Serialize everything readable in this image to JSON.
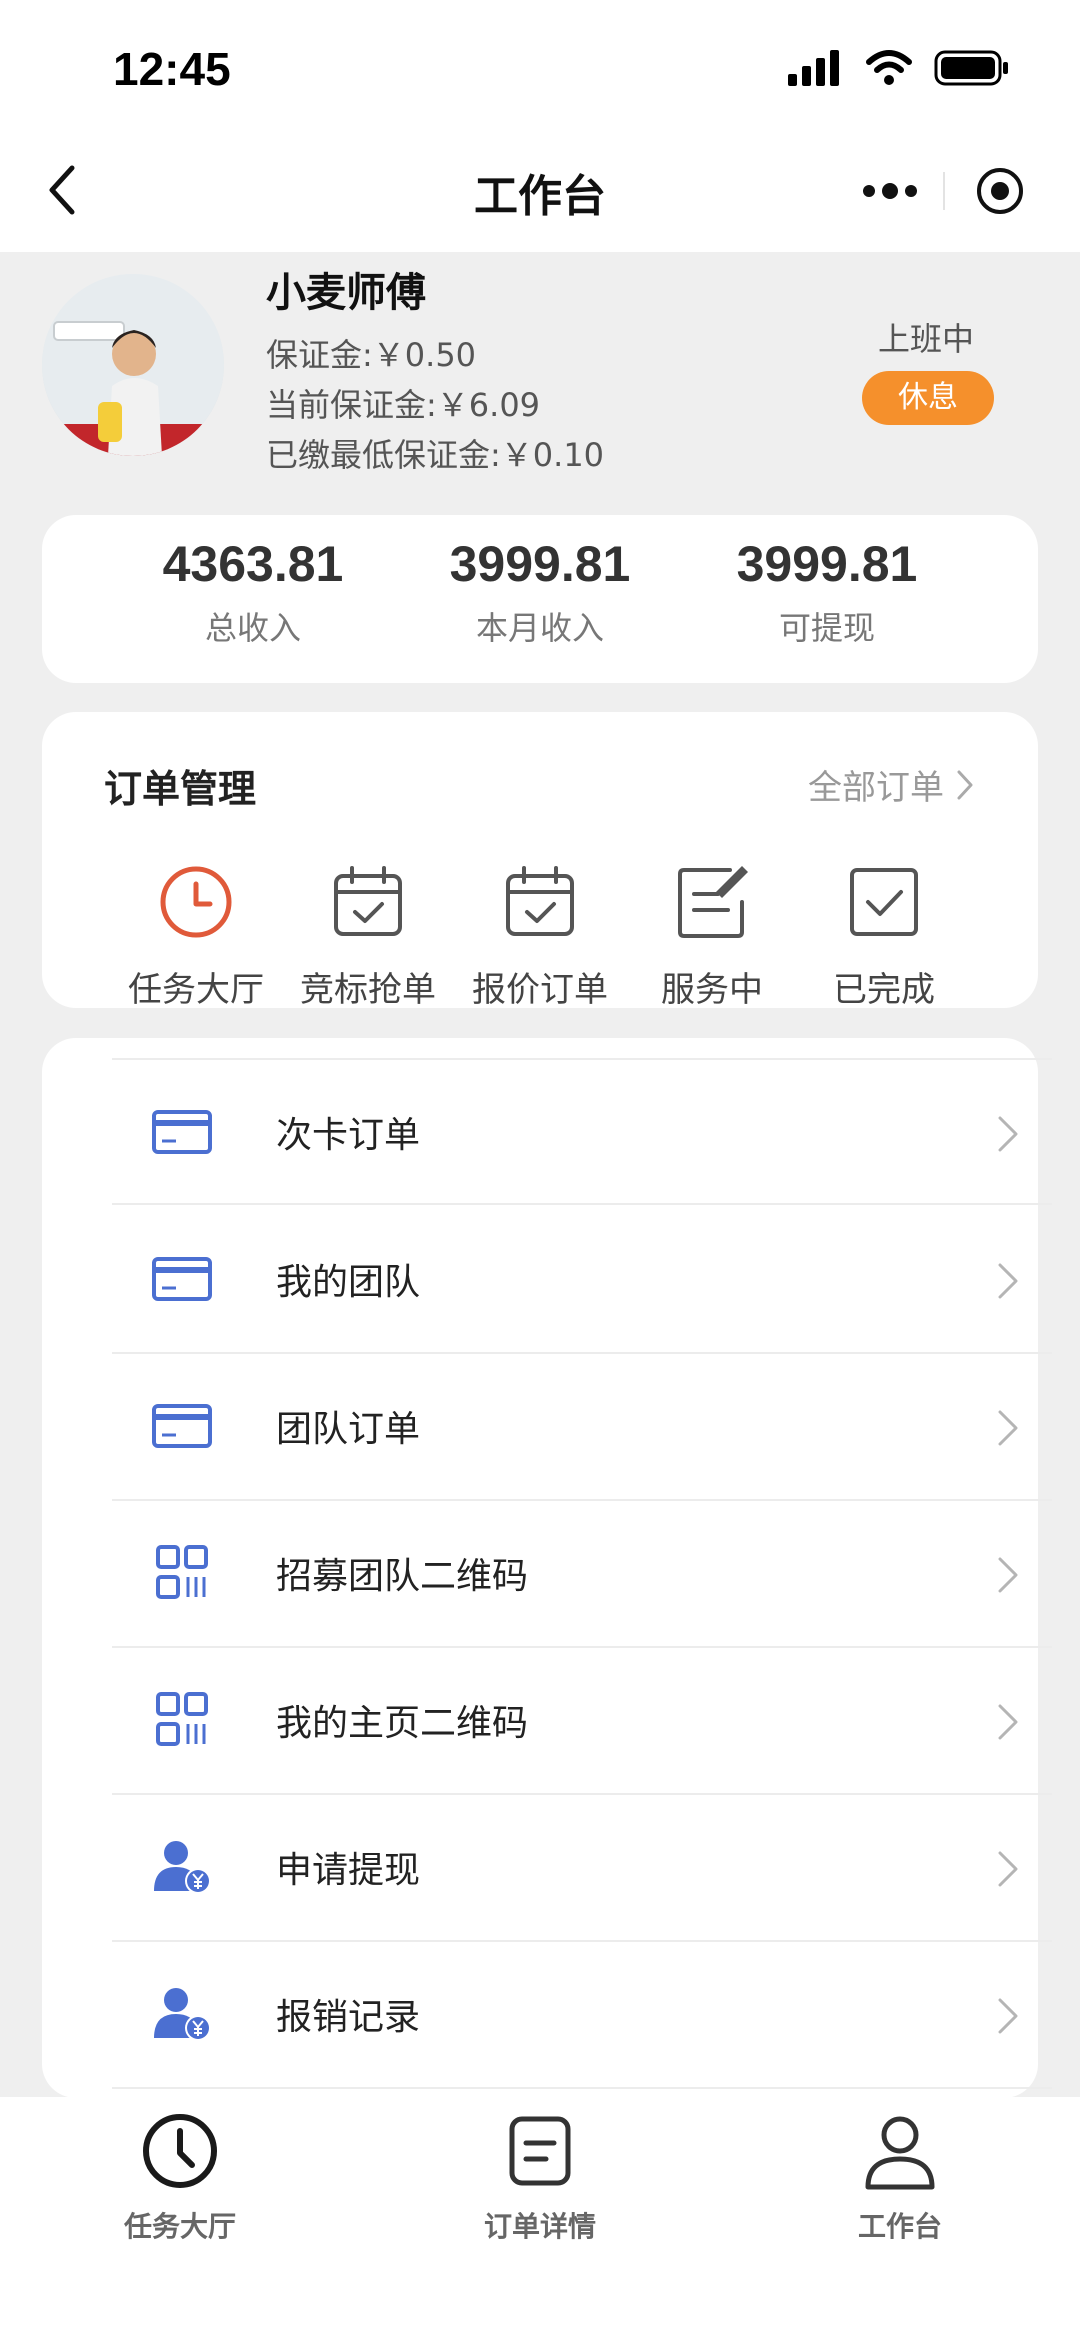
{
  "status_bar": {
    "time": "12:45"
  },
  "nav": {
    "title": "工作台"
  },
  "profile": {
    "name": "小麦师傅",
    "deposit": "保证金:￥0.50",
    "current_deposit": "当前保证金:￥6.09",
    "min_deposit_paid": "已缴最低保证金:￥0.10",
    "work_status": "上班中",
    "rest_button": "休息"
  },
  "stats": [
    {
      "value": "4363.81",
      "label": "总收入"
    },
    {
      "value": "3999.81",
      "label": "本月收入"
    },
    {
      "value": "3999.81",
      "label": "可提现"
    }
  ],
  "orders": {
    "title": "订单管理",
    "all_link": "全部订单",
    "tabs": [
      {
        "label": "任务大厅",
        "icon": "clock-icon"
      },
      {
        "label": "竞标抢单",
        "icon": "calendar-check-icon"
      },
      {
        "label": "报价订单",
        "icon": "calendar-check-icon"
      },
      {
        "label": "服务中",
        "icon": "edit-note-icon"
      },
      {
        "label": "已完成",
        "icon": "checkbox-icon"
      }
    ]
  },
  "menu": [
    {
      "label": "次卡订单",
      "icon": "card-icon"
    },
    {
      "label": "我的团队",
      "icon": "card-icon"
    },
    {
      "label": "团队订单",
      "icon": "card-icon"
    },
    {
      "label": "招募团队二维码",
      "icon": "qrcode-icon"
    },
    {
      "label": "我的主页二维码",
      "icon": "qrcode-icon"
    },
    {
      "label": "申请提现",
      "icon": "user-yen-icon"
    },
    {
      "label": "报销记录",
      "icon": "user-yen-icon"
    }
  ],
  "tabbar": [
    {
      "label": "任务大厅",
      "icon": "clock-icon"
    },
    {
      "label": "订单详情",
      "icon": "document-icon"
    },
    {
      "label": "工作台",
      "icon": "person-icon"
    }
  ],
  "colors": {
    "accent_orange": "#f5902c",
    "icon_blue": "#4b6fd1",
    "icon_red": "#e05a3a"
  }
}
